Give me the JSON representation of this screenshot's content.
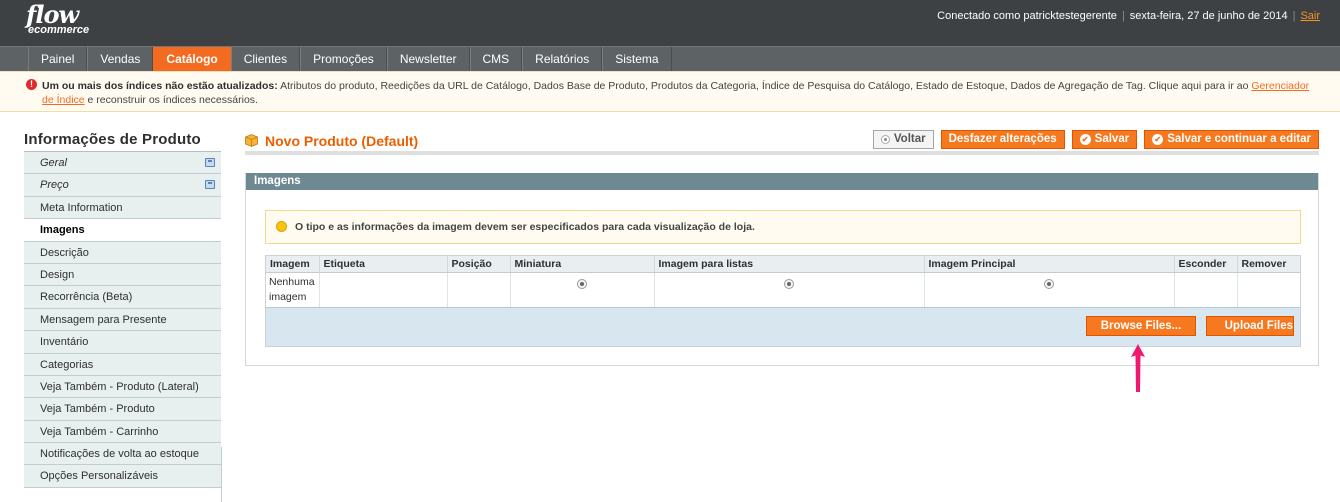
{
  "header": {
    "logo_line1": "flow",
    "logo_line2": "ecommerce",
    "connected": "Conectado como patricktestegerente",
    "date": "sexta-feira, 27 de junho de 2014",
    "logout": "Sair"
  },
  "nav": {
    "items": [
      "Painel",
      "Vendas",
      "Catálogo",
      "Clientes",
      "Promoções",
      "Newsletter",
      "CMS",
      "Relatórios",
      "Sistema"
    ],
    "active": "Catálogo"
  },
  "message": {
    "bold": "Um ou mais dos índices não estão atualizados:",
    "text": " Atributos do produto, Reedições da URL de Catálogo, Dados Base de Produto, Produtos da Categoria, Índice de Pesquisa do Catálogo, Estado de Estoque, Dados de Agregação de Tag. Clique aqui para ir ao ",
    "link": "Gerenciador de Índice",
    "tail": " e reconstruir os índices necessários."
  },
  "sidebar": {
    "title": "Informações de Produto",
    "items": [
      {
        "label": "Geral"
      },
      {
        "label": "Preço"
      },
      {
        "label": "Meta Information"
      },
      {
        "label": "Imagens"
      },
      {
        "label": "Descrição"
      },
      {
        "label": "Design"
      },
      {
        "label": "Recorrência (Beta)"
      },
      {
        "label": "Mensagem para Presente"
      },
      {
        "label": "Inventário"
      },
      {
        "label": "Categorias"
      },
      {
        "label": "Veja Também - Produto (Lateral)"
      },
      {
        "label": "Veja Também - Produto"
      },
      {
        "label": "Veja Também - Carrinho"
      },
      {
        "label": "Notificações de volta ao estoque"
      },
      {
        "label": "Opções Personalizáveis"
      }
    ]
  },
  "main": {
    "title": "Novo Produto (Default)",
    "buttons": {
      "back": "Voltar",
      "reset": "Desfazer alterações",
      "save": "Salvar",
      "save_continue": "Salvar e continuar a editar"
    },
    "section_title": "Imagens",
    "notice": "O tipo e as informações da imagem devem ser especificados para cada visualização de loja.",
    "grid": {
      "headers": [
        "Imagem",
        "Etiqueta",
        "Posição",
        "Miniatura",
        "Imagem para listas",
        "Imagem Principal",
        "Esconder",
        "Remover"
      ],
      "row_text": "Nenhuma imagem"
    },
    "browse_label": "Browse Files...",
    "upload_label": "Upload Files"
  },
  "colors": {
    "accent": "#f26b21",
    "arrow": "#f0186e"
  }
}
